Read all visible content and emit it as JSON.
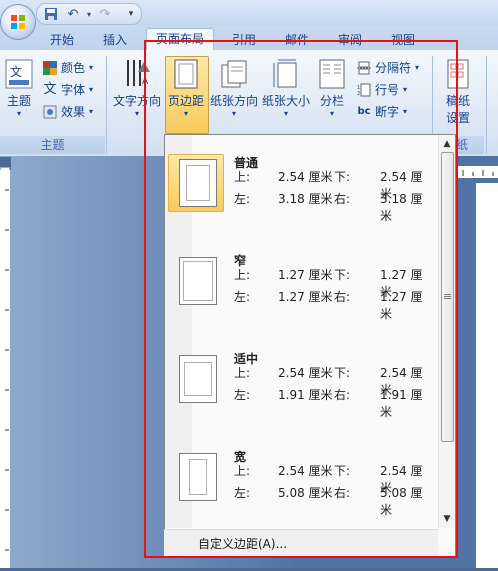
{
  "tabs": [
    {
      "label": "开始"
    },
    {
      "label": "插入"
    },
    {
      "label": "页面布局"
    },
    {
      "label": "引用"
    },
    {
      "label": "邮件"
    },
    {
      "label": "审阅"
    },
    {
      "label": "视图"
    }
  ],
  "ribbon": {
    "theme": {
      "label": "主题",
      "colors": "颜色",
      "fonts": "字体",
      "effects": "效果",
      "group": "主题"
    },
    "text_direction": "文字方向",
    "margins": "页边距",
    "orientation": "纸张方向",
    "size": "纸张大小",
    "columns": "分栏",
    "breaks": "分隔符",
    "line_numbers": "行号",
    "hyphenation": "断字",
    "draft_line1": "稿纸",
    "draft_line2": "设置",
    "draft_group": "纸"
  },
  "margins_menu": {
    "presets": [
      {
        "name": "普通",
        "top": "2.54 厘米",
        "bottom": "2.54 厘米",
        "left": "3.18 厘米",
        "right": "3.18 厘米"
      },
      {
        "name": "窄",
        "top": "1.27 厘米",
        "bottom": "1.27 厘米",
        "left": "1.27 厘米",
        "right": "1.27 厘米"
      },
      {
        "name": "适中",
        "top": "2.54 厘米",
        "bottom": "2.54 厘米",
        "left": "1.91 厘米",
        "right": "1.91 厘米"
      },
      {
        "name": "宽",
        "top": "2.54 厘米",
        "bottom": "2.54 厘米",
        "left": "5.08 厘米",
        "right": "5.08 厘米"
      }
    ],
    "labels": {
      "top": "上:",
      "bottom": "下:",
      "left": "左:",
      "right": "右:"
    },
    "custom": "自定义边距(A)..."
  },
  "colors": {
    "highlight": "#e0141d",
    "selected": "#f8cb5b"
  }
}
